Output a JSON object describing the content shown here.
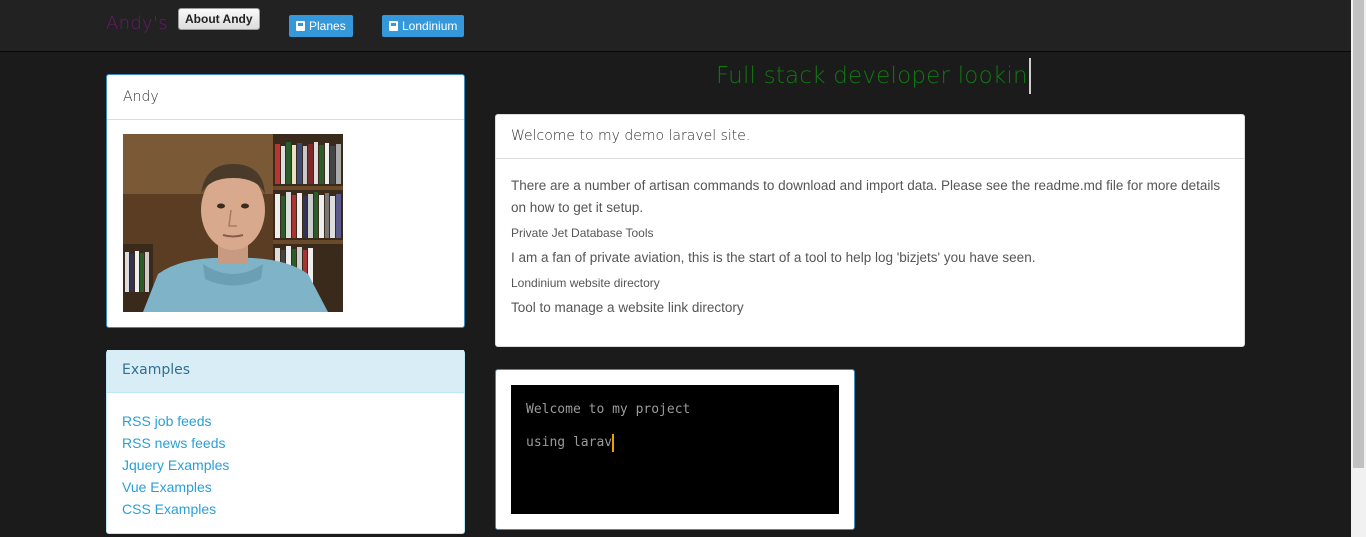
{
  "navbar": {
    "brand": "Andy's",
    "about_button": "About Andy",
    "links": [
      {
        "label": "Planes",
        "icon": "building-icon"
      },
      {
        "label": "Londinium",
        "icon": "building-icon"
      }
    ]
  },
  "profile": {
    "heading": "Andy",
    "photo_alt": "portrait photo"
  },
  "examples": {
    "heading": "Examples",
    "items": [
      "RSS job feeds",
      "RSS news feeds",
      "Jquery Examples",
      "Vue Examples",
      "CSS Examples"
    ]
  },
  "typed_title": "Full stack developer lookin",
  "welcome": {
    "heading": "Welcome to my demo laravel site.",
    "intro": "There are a number of artisan commands to download and import data. Please see the readme.md file for more details on how to get it setup.",
    "sections": [
      {
        "title": "Private Jet Database Tools",
        "text": "I am a fan of private aviation, this is the start of a tool to help log 'bizjets' you have seen."
      },
      {
        "title": "Londinium website directory",
        "text": "Tool to manage a website link directory"
      }
    ]
  },
  "terminal": {
    "line1": "Welcome to my project",
    "line2": "using larav"
  },
  "colors": {
    "navbar_bg": "#222222",
    "page_bg": "#1b1b1b",
    "brand": "#6a1b6a",
    "nav_button": "#3498db",
    "title_green": "#0f7a0f",
    "link": "#2a9fd6",
    "info_bg": "#d9edf7",
    "cursor_orange": "#f0a000"
  }
}
